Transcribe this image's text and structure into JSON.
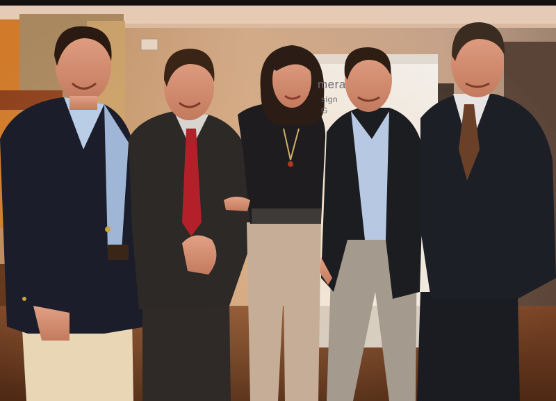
{
  "image": {
    "kind": "photograph",
    "scene": "group-portrait-indoor-event",
    "people_count": 5
  },
  "banner": {
    "word": "mera",
    "line2": "sign",
    "line3": "G"
  },
  "colors": {
    "background_wall": "#c9a78a",
    "floor": "#6b3a1f",
    "blazer_navy": "#1b1d2a",
    "suit_dark": "#2a2624",
    "chino_khaki": "#e8d6b5",
    "tie_red": "#b3202a",
    "tie_brown": "#6b4028",
    "banner_white": "#f2f1ef"
  },
  "icons": []
}
